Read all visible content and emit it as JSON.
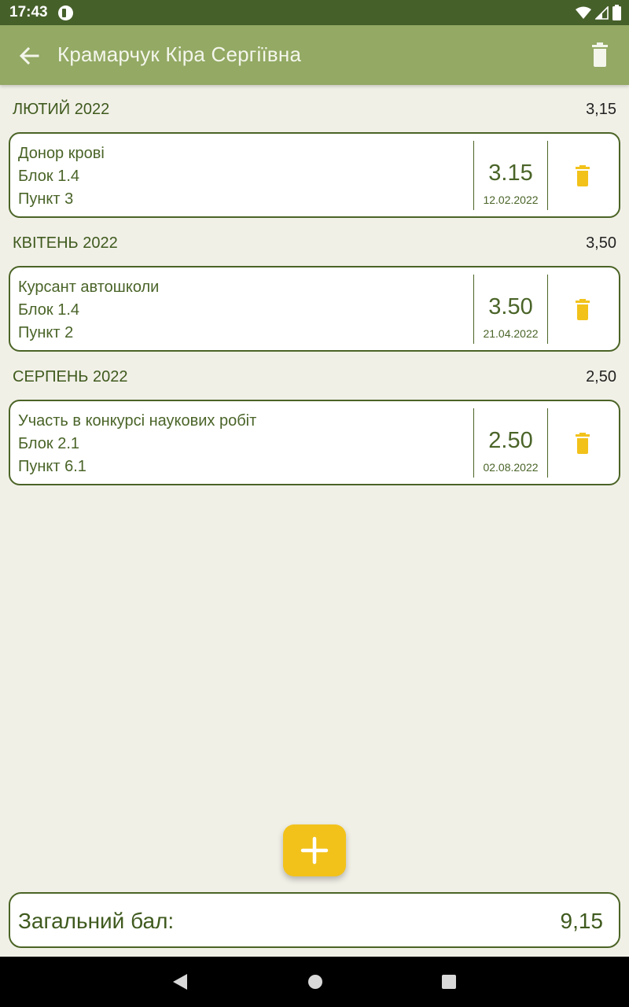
{
  "status_bar": {
    "time": "17:43"
  },
  "app_bar": {
    "title": "Крамарчук Кіра Сергіївна"
  },
  "sections": [
    {
      "month": "ЛЮТИЙ 2022",
      "sum": "3,15",
      "entry": {
        "name": "Донор крові",
        "block": "Блок 1.4",
        "item": "Пункт 3",
        "points": "3.15",
        "date": "12.02.2022"
      }
    },
    {
      "month": "КВІТЕНЬ 2022",
      "sum": "3,50",
      "entry": {
        "name": "Курсант автошколи",
        "block": "Блок 1.4",
        "item": "Пункт 2",
        "points": "3.50",
        "date": "21.04.2022"
      }
    },
    {
      "month": "СЕРПЕНЬ 2022",
      "sum": "2,50",
      "entry": {
        "name": "Участь в конкурсі наукових робіт",
        "block": "Блок 2.1",
        "item": "Пункт 6.1",
        "points": "2.50",
        "date": "02.08.2022"
      }
    }
  ],
  "total": {
    "label": "Загальний бал:",
    "value": "9,15"
  },
  "colors": {
    "status_bar": "#46602a",
    "app_bar": "#93a964",
    "background": "#f1f0e7",
    "text_green": "#4a6428",
    "accent_yellow": "#f2c21b"
  },
  "icons": {
    "back": "arrow-left-icon",
    "delete_all": "trash-icon",
    "delete_entry": "trash-icon",
    "add": "plus-icon"
  }
}
